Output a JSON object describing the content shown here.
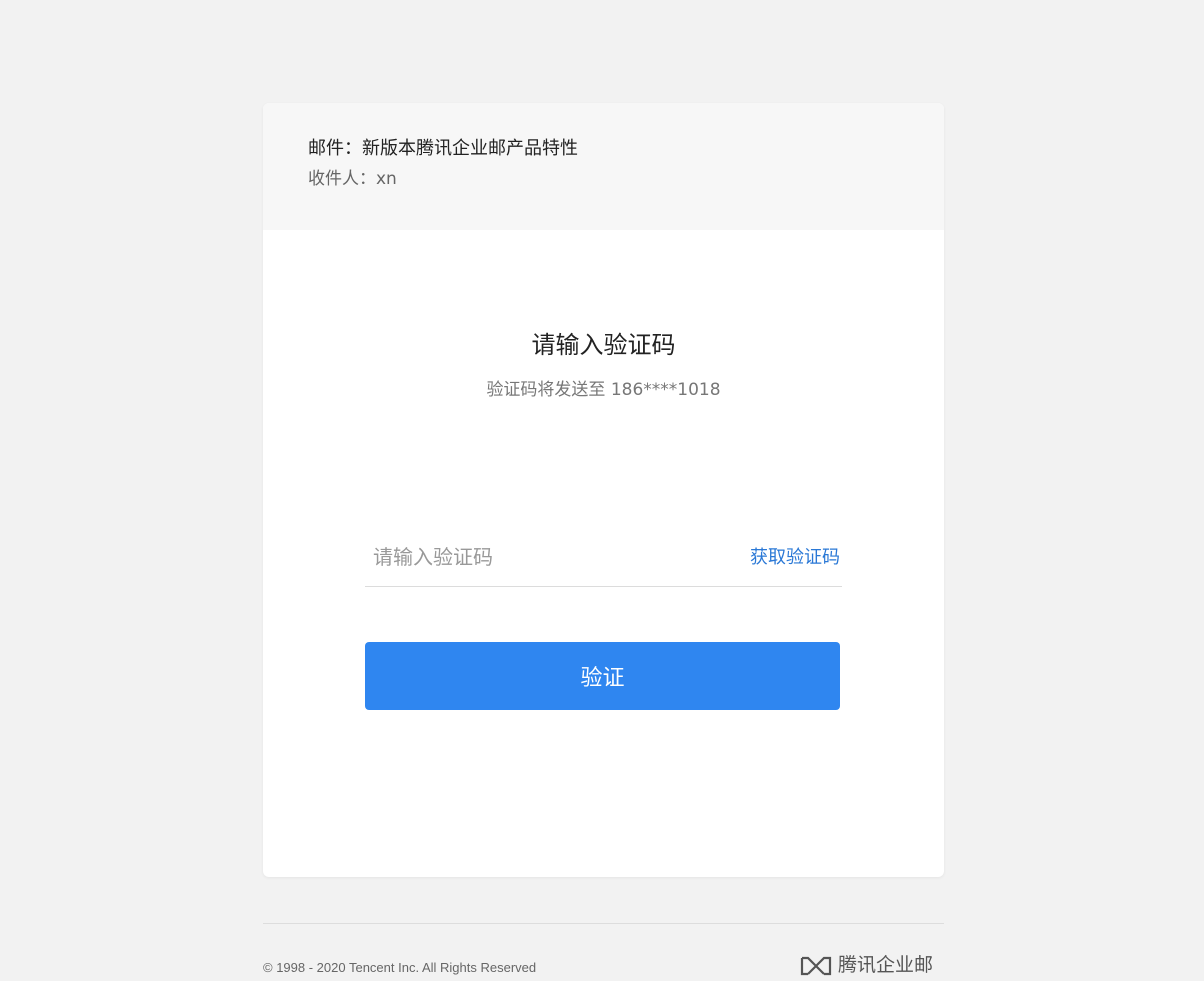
{
  "mail": {
    "subject": "邮件：新版本腾讯企业邮产品特性",
    "recipient": "收件人：xn"
  },
  "verify": {
    "title": "请输入验证码",
    "subtitle": "验证码将发送至 186****1018",
    "code_placeholder": "请输入验证码",
    "code_value": "",
    "get_code_label": "获取验证码",
    "submit_label": "验证"
  },
  "footer": {
    "copyright": "© 1998 - 2020 Tencent Inc. All Rights Reserved",
    "brand_name": "腾讯企业邮",
    "brand_icon": "tencent-exmail-logo-icon"
  },
  "colors": {
    "background": "#f2f2f2",
    "card": "#ffffff",
    "header": "#f7f7f7",
    "accent": "#2f86f0",
    "link": "#2a78d6"
  }
}
